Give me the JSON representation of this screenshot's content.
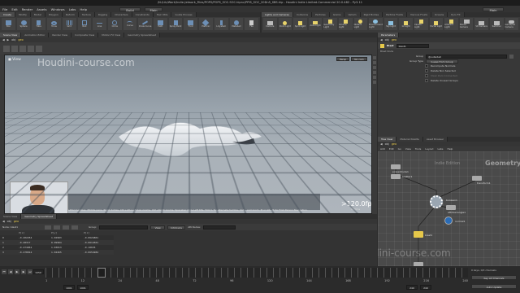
{
  "window": {
    "title": "/N:/Lib/Work/Indie-Jetwork_Files/POPS/POPS_SOC.SOC.hipnc/PPIS_SOC_20Dn5_SBS.hip - Houdini Indie Limited-Commercial 20.0.482 - Py3.11"
  },
  "menu": [
    "File",
    "Edit",
    "Render",
    "Assets",
    "Windows",
    "Labs",
    "Help"
  ],
  "top_selectors": {
    "desktop": "Build",
    "context": "Main",
    "right_label": "Main"
  },
  "shelf_tabs_left": [
    "Create",
    "Modify",
    "Model",
    "Polygon",
    "Deform",
    "Texture",
    "Rigging",
    "Characters",
    "Constraints",
    "Hair Utils",
    "Guide Process",
    "Terrain FX",
    "Simple FX",
    "Volume",
    "SideFX Labs"
  ],
  "shelf_tools_left": [
    "Box",
    "Sphere",
    "Tube",
    "Torus",
    "Grid",
    "Null",
    "Line",
    "Circle",
    "Curve",
    "Draw Curve",
    "Path",
    "Spray Paint",
    "Font",
    "Platonic",
    "L-System",
    "Metaball",
    "File"
  ],
  "shelf_tabs_right": [
    "Lights and Cameras",
    "Collisions",
    "Particles",
    "Grains",
    "Vellum",
    "Rigid Bodies",
    "Particle Fluids",
    "Viscous Fluids",
    "Oceans",
    "Pyro FX",
    "FEM",
    "Wires",
    "Crowds",
    "Drive Simulation"
  ],
  "shelf_tools_right": [
    "Camera",
    "Point Light",
    "Spot Light",
    "Area Light",
    "Geometry Light",
    "Volume Light",
    "Distant Light",
    "Environment Light",
    "Sky Light",
    "GI Light",
    "Caustic Light",
    "Portal Light",
    "Ambient Light",
    "Stereo Camera",
    "VR Camera",
    "Switcher",
    "Gamepad Camera"
  ],
  "viewer_tabs": [
    "Scene View",
    "Animation Editor",
    "Render View",
    "Composite View",
    "Motion FX View",
    "Geometry Spreadsheet"
  ],
  "viewer_path": [
    "obj",
    "geo"
  ],
  "viewport": {
    "label": "View",
    "persp_btn": "Persp",
    "cam_btn": "No cam",
    "watermark": "Houdini-course.com",
    "status_hint": "Left button tumbles. Middle pans. Right dollies. Ctrl+Alt+Left box zooms. Ctrl+Right zooms. Spacebar Ctrl+Left tilts. Hold L for alternate tumble, dolly, and zoom. M or Alt+M for First Person Navigation.",
    "fps": ">120.0fps",
    "fps_sub": "0.73ms"
  },
  "param_panel": {
    "tabs": [
      "Parameters"
    ],
    "path": [
      "obj",
      "geo"
    ],
    "node_type": "Blast",
    "node_name": "blast1",
    "section": "Blast Node",
    "group_label": "Group",
    "group_value": "@outside0",
    "group_type_label": "Group Type",
    "group_type_value": "Guess from Group",
    "checkboxes": [
      {
        "label": "Recompute Normals",
        "checked": false
      },
      {
        "label": "Delete Non Selected",
        "checked": false
      },
      {
        "label": "Clear Zero Connected",
        "checked": false
      },
      {
        "label": "Delete Unused Groups",
        "checked": false
      }
    ]
  },
  "network": {
    "tabs": [
      "Tree View",
      "Material Palette",
      "Asset Browser"
    ],
    "path": [
      "obj",
      "geo"
    ],
    "menus": [
      "Add",
      "Edit",
      "Go",
      "View",
      "Tools",
      "Layout",
      "Labs",
      "Help"
    ],
    "context_label": "Indie Edition",
    "context_type": "Geometry",
    "watermark": "Houdini-course.com",
    "nodes": [
      {
        "name": "polyextrude1",
        "type": "generic"
      },
      {
        "name": "scatter1",
        "type": "generic"
      },
      {
        "name": "transform1",
        "type": "generic"
      },
      {
        "name": "boolean1",
        "type": "boolean"
      },
      {
        "name": "attribwrangle1",
        "type": "generic"
      },
      {
        "name": "normal1",
        "type": "generic"
      },
      {
        "name": "blast1",
        "type": "selected"
      }
    ],
    "selected_caption": "Boolean1 (Boolean) node"
  },
  "spreadsheet": {
    "tabs": [
      "Scene View",
      "Geometry Spreadsheet"
    ],
    "path": [
      "obj",
      "geo"
    ],
    "node_label": "Node: blast1",
    "group_label": "Group:",
    "view_label": "View",
    "intrinsics_label": "Intrinsics",
    "attributes_label": "Attributes:",
    "columns": [
      "",
      "P[x]",
      "P[y]",
      "P[z]"
    ],
    "rows": [
      [
        "0",
        "-0.402254",
        "1.02983",
        "-0.0624801"
      ],
      [
        "1",
        "-0.48317",
        "0.99984",
        "-0.0614501"
      ],
      [
        "2",
        "-0.474061",
        "1.03813",
        "-0.10635"
      ],
      [
        "3",
        "-0.478814",
        "1.04465",
        "-0.0654984"
      ]
    ]
  },
  "timeline": {
    "current_frame": "1059",
    "tick_labels": [
      "1",
      "12",
      "24",
      "48",
      "72",
      "96",
      "120",
      "144",
      "168",
      "192",
      "216",
      "240"
    ],
    "start_a": "1001",
    "start_b": "1001",
    "end_a": "240",
    "end_b": "240",
    "keys_label": "0 keys, 0/0 channels",
    "key_all_label": "Key All Channels",
    "auto_update": "Auto Update"
  },
  "colors": {
    "accent_blue": "#6d8fb5",
    "selected_node": "#e6c84a",
    "boolean_node": "#9aa6b2"
  }
}
